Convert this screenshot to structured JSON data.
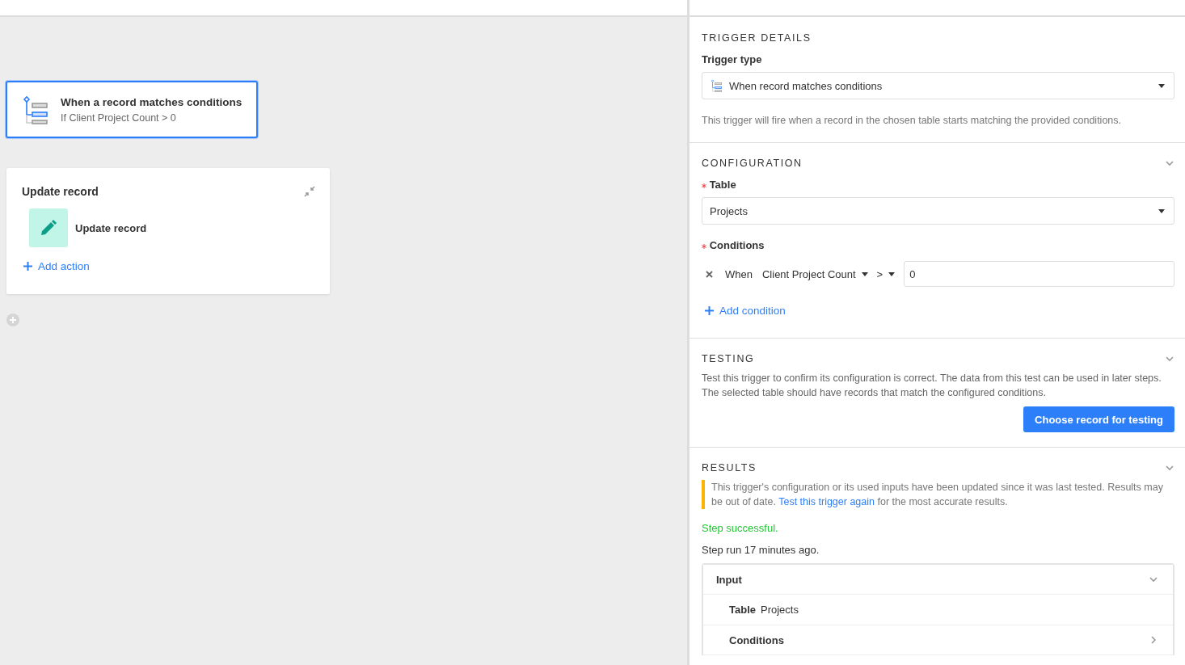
{
  "canvas": {
    "trigger": {
      "title": "When a record matches conditions",
      "subtitle": "If Client Project Count > 0",
      "selected": true
    },
    "step": {
      "title": "Update record",
      "actions": [
        {
          "label": "Update record"
        }
      ],
      "add_action": "Add action"
    }
  },
  "panel": {
    "trigger_details": {
      "heading": "TRIGGER DETAILS",
      "label": "Trigger type",
      "value": "When record matches conditions",
      "description": "This trigger will fire when a record in the chosen table starts matching the provided conditions."
    },
    "configuration": {
      "heading": "CONFIGURATION",
      "expanded": true,
      "table_label": "Table",
      "table_required": true,
      "table_value": "Projects",
      "conditions_label": "Conditions",
      "conditions_required": true,
      "conditions": [
        {
          "prefix": "When",
          "field": "Client Project Count",
          "operator": ">",
          "value": "0"
        }
      ],
      "add_condition": "Add condition"
    },
    "testing": {
      "heading": "TESTING",
      "expanded": true,
      "description": "Test this trigger to confirm its configuration is correct. The data from this test can be used in later steps. The selected table should have records that match the configured conditions.",
      "button": "Choose record for testing"
    },
    "results": {
      "heading": "RESULTS",
      "expanded": true,
      "warning_before": "This trigger's configuration or its used inputs have been updated since it was last tested. Results may be out of date.",
      "warning_link": "Test this trigger again",
      "warning_after": "for the most accurate results.",
      "status": "Step successful.",
      "run_info": "Step run 17 minutes ago.",
      "groups": [
        {
          "label": "Input",
          "expanded": true,
          "rows": [
            {
              "kind": "field",
              "key": "Table",
              "value": "Projects"
            },
            {
              "kind": "group",
              "label": "Conditions",
              "expanded": false
            }
          ]
        }
      ]
    }
  }
}
